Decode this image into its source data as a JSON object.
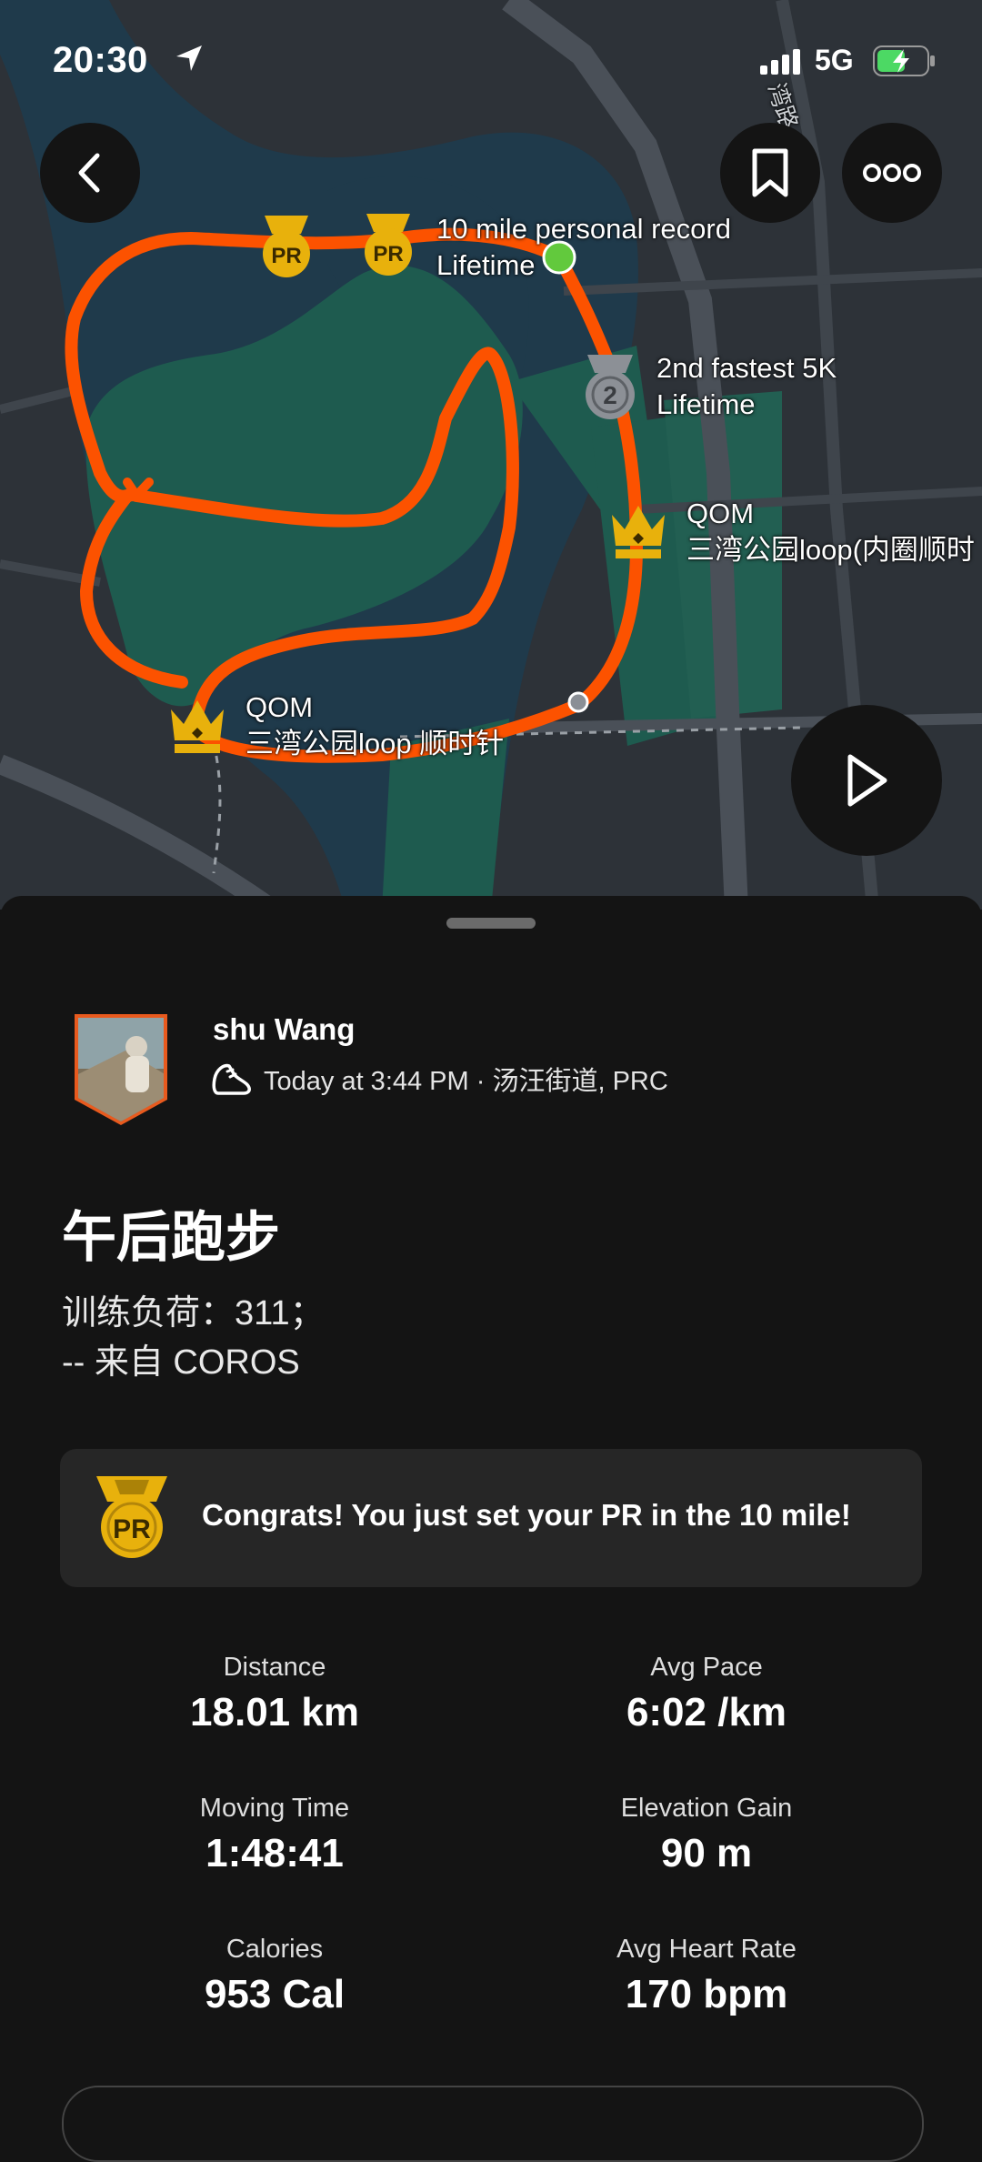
{
  "status_bar": {
    "time": "20:30",
    "network": "5G",
    "location_icon": "location-arrow-icon",
    "signal_icon": "signal-bars-icon",
    "battery_icon": "battery-charging-icon"
  },
  "map": {
    "street_label": "湾路",
    "achievements": [
      {
        "title": "10 mile personal record",
        "subtitle": "Lifetime"
      },
      {
        "title": "2nd fastest 5K",
        "subtitle": "Lifetime"
      },
      {
        "title": "QOM",
        "subtitle": "三湾公园loop(内圈顺时"
      },
      {
        "title": "QOM",
        "subtitle": "三湾公园loop 顺时针"
      }
    ],
    "pr_badge_text": "PR",
    "second_badge_text": "2",
    "route_color": "#fc5200",
    "park_color": "#1e5b4f",
    "river_color": "#1f3a4b"
  },
  "activity": {
    "athlete_name": "shu Wang",
    "meta": "Today at 3:44 PM · 汤汪街道, PRC",
    "title": "午后跑步",
    "description_line1": "训练负荷：311；",
    "description_line2": "-- 来自 COROS",
    "pr_message": "Congrats! You just set your PR in the 10 mile!",
    "pr_badge_text": "PR"
  },
  "stats": [
    {
      "label": "Distance",
      "value": "18.01 km"
    },
    {
      "label": "Avg Pace",
      "value": "6:02 /km"
    },
    {
      "label": "Moving Time",
      "value": "1:48:41"
    },
    {
      "label": "Elevation Gain",
      "value": "90 m"
    },
    {
      "label": "Calories",
      "value": "953 Cal"
    },
    {
      "label": "Avg Heart Rate",
      "value": "170 bpm"
    }
  ],
  "colors": {
    "accent": "#fc5200",
    "gold": "#e8b10c",
    "sheet_bg": "#141414",
    "card_bg": "#262626"
  }
}
